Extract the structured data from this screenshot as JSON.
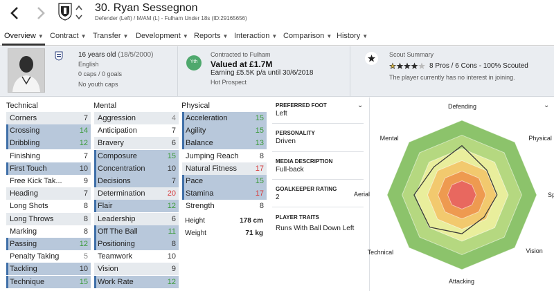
{
  "header": {
    "title": "30. Ryan Sessegnon",
    "subtitle": "Defender (Left) / M/AM (L) - Fulham Under 18s (ID:29165656)",
    "back_icon": "chevron-left-icon",
    "forward_icon": "chevron-right-icon",
    "badge_icon": "club-badge-icon"
  },
  "tabs": [
    {
      "label": "Overview"
    },
    {
      "label": "Contract"
    },
    {
      "label": "Transfer"
    },
    {
      "label": "Development"
    },
    {
      "label": "Reports"
    },
    {
      "label": "Interaction"
    },
    {
      "label": "Comparison"
    },
    {
      "label": "History"
    }
  ],
  "info": {
    "age": "16 years old",
    "dob": "(18/5/2000)",
    "nationality": "English",
    "caps": "0 caps / 0 goals",
    "youth_caps": "No youth caps",
    "contract_circle": "Yth",
    "contract_to": "Contracted to Fulham",
    "value": "Valued at £1.7M",
    "earning": "Earning £5.5K p/a until 30/6/2018",
    "status": "Hot Prospect",
    "scout_title": "Scout Summary",
    "star_rating": 3.5,
    "scout_summary": "8 Pros / 6 Cons - 100% Scouted",
    "scout_interest": "The player currently has no interest in joining."
  },
  "colors": {
    "green": "#3a9a3a",
    "red": "#d63a3a",
    "grey": "#888888",
    "accent_bar": "#3f6fa8",
    "star": "#2b2b2b"
  },
  "technical": {
    "title": "Technical",
    "rows": [
      {
        "label": "Corners",
        "value": "7",
        "color": "normal"
      },
      {
        "label": "Crossing",
        "value": "14",
        "color": "green"
      },
      {
        "label": "Dribbling",
        "value": "12",
        "color": "green"
      },
      {
        "label": "Finishing",
        "value": "7",
        "color": "normal"
      },
      {
        "label": "First Touch",
        "value": "10",
        "color": "normal"
      },
      {
        "label": "Free Kick Tak...",
        "value": "9",
        "color": "normal"
      },
      {
        "label": "Heading",
        "value": "7",
        "color": "normal"
      },
      {
        "label": "Long Shots",
        "value": "8",
        "color": "normal"
      },
      {
        "label": "Long Throws",
        "value": "8",
        "color": "normal"
      },
      {
        "label": "Marking",
        "value": "8",
        "color": "normal"
      },
      {
        "label": "Passing",
        "value": "12",
        "color": "green"
      },
      {
        "label": "Penalty Taking",
        "value": "5",
        "color": "grey"
      },
      {
        "label": "Tackling",
        "value": "10",
        "color": "normal"
      },
      {
        "label": "Technique",
        "value": "15",
        "color": "green"
      }
    ]
  },
  "mental": {
    "title": "Mental",
    "rows": [
      {
        "label": "Aggression",
        "value": "4",
        "color": "grey"
      },
      {
        "label": "Anticipation",
        "value": "7",
        "color": "normal"
      },
      {
        "label": "Bravery",
        "value": "6",
        "color": "normal"
      },
      {
        "label": "Composure",
        "value": "15",
        "color": "green"
      },
      {
        "label": "Concentration",
        "value": "10",
        "color": "normal"
      },
      {
        "label": "Decisions",
        "value": "7",
        "color": "normal"
      },
      {
        "label": "Determination",
        "value": "20",
        "color": "red"
      },
      {
        "label": "Flair",
        "value": "12",
        "color": "green"
      },
      {
        "label": "Leadership",
        "value": "6",
        "color": "normal"
      },
      {
        "label": "Off The Ball",
        "value": "11",
        "color": "green"
      },
      {
        "label": "Positioning",
        "value": "8",
        "color": "normal"
      },
      {
        "label": "Teamwork",
        "value": "10",
        "color": "normal"
      },
      {
        "label": "Vision",
        "value": "9",
        "color": "normal"
      },
      {
        "label": "Work Rate",
        "value": "12",
        "color": "green"
      }
    ]
  },
  "physical": {
    "title": "Physical",
    "rows": [
      {
        "label": "Acceleration",
        "value": "15",
        "color": "green"
      },
      {
        "label": "Agility",
        "value": "15",
        "color": "green"
      },
      {
        "label": "Balance",
        "value": "13",
        "color": "green"
      },
      {
        "label": "Jumping Reach",
        "value": "8",
        "color": "normal"
      },
      {
        "label": "Natural Fitness",
        "value": "17",
        "color": "red"
      },
      {
        "label": "Pace",
        "value": "15",
        "color": "green"
      },
      {
        "label": "Stamina",
        "value": "17",
        "color": "red"
      },
      {
        "label": "Strength",
        "value": "8",
        "color": "normal"
      }
    ],
    "height_label": "Height",
    "height_value": "178 cm",
    "weight_label": "Weight",
    "weight_value": "71 kg"
  },
  "details": {
    "foot_title": "PREFERRED FOOT",
    "foot_value": "Left",
    "personality_title": "PERSONALITY",
    "personality_value": "Driven",
    "media_title": "MEDIA DESCRIPTION",
    "media_value": "Full-back",
    "gk_title": "GOALKEEPER RATING",
    "gk_value": "2",
    "traits_title": "PLAYER TRAITS",
    "traits_value": "Runs With Ball Down Left"
  },
  "radar": {
    "labels": [
      "Defending",
      "Physical",
      "Speed",
      "Vision",
      "Attacking",
      "Technical",
      "Aerial",
      "Mental"
    ],
    "values": [
      0.66,
      0.47,
      0.47,
      0.42,
      0.52,
      0.61,
      0.64,
      0.53
    ],
    "ring_colors": [
      "#8cc36b",
      "#b5d880",
      "#e9ee9c",
      "#f2c96e",
      "#ee9a50",
      "#e8685f"
    ]
  }
}
